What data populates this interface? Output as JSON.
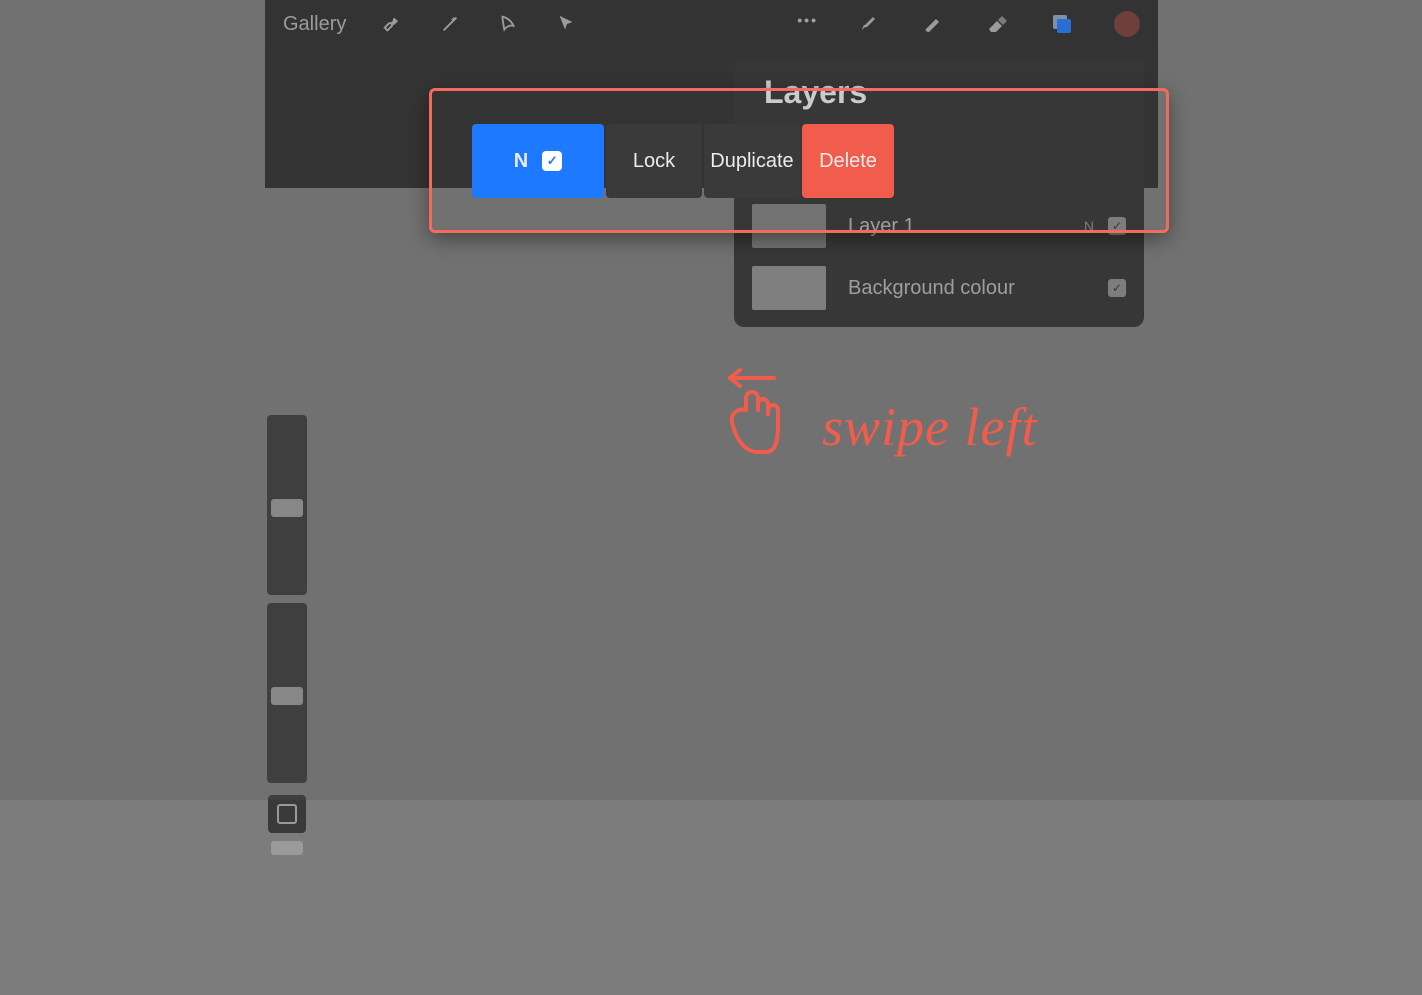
{
  "toolbar": {
    "gallery_label": "Gallery"
  },
  "layers_panel": {
    "title": "Layers",
    "layer1_label": "Layer 1",
    "layer1_mode": "N",
    "bg_label": "Background colour"
  },
  "swipe_row": {
    "blend_mode": "N",
    "lock_label": "Lock",
    "duplicate_label": "Duplicate",
    "delete_label": "Delete"
  },
  "annotation": {
    "text": "swipe left"
  }
}
